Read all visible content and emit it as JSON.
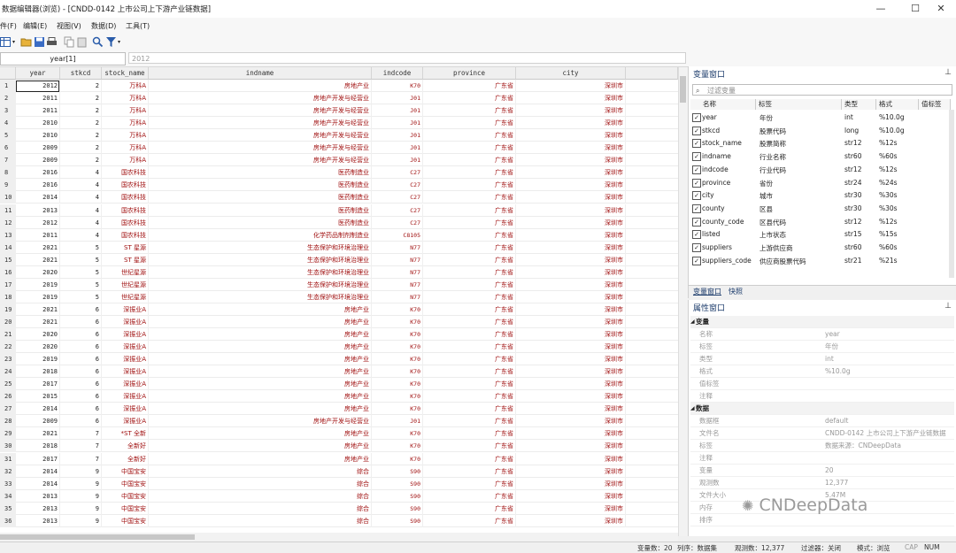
{
  "window": {
    "title": "数据编辑器(浏览) - [CNDD-0142 上市公司上下游产业链数据]",
    "minimize": "—",
    "maximize": "☐",
    "close": "✕"
  },
  "menus": [
    "件(F)",
    "编辑(E)",
    "视图(V)",
    "数据(D)",
    "工具(T)"
  ],
  "toolbar": [
    "table-icon",
    "open-icon",
    "save-icon",
    "print-icon",
    "copy-icon",
    "paste-icon",
    "search-icon",
    "filter-icon"
  ],
  "formula_bar": {
    "cell_ref": "year[1]",
    "value": "2012"
  },
  "grid": {
    "columns": [
      "year",
      "stkcd",
      "stock_name",
      "indname",
      "indcode",
      "province",
      "city"
    ],
    "rows": [
      [
        "2012",
        "2",
        "万科A",
        "房地产业",
        "K70",
        "广东省",
        "深圳市"
      ],
      [
        "2011",
        "2",
        "万科A",
        "房地产开发与经营业",
        "J01",
        "广东省",
        "深圳市"
      ],
      [
        "2011",
        "2",
        "万科A",
        "房地产开发与经营业",
        "J01",
        "广东省",
        "深圳市"
      ],
      [
        "2010",
        "2",
        "万科A",
        "房地产开发与经营业",
        "J01",
        "广东省",
        "深圳市"
      ],
      [
        "2010",
        "2",
        "万科A",
        "房地产开发与经营业",
        "J01",
        "广东省",
        "深圳市"
      ],
      [
        "2009",
        "2",
        "万科A",
        "房地产开发与经营业",
        "J01",
        "广东省",
        "深圳市"
      ],
      [
        "2009",
        "2",
        "万科A",
        "房地产开发与经营业",
        "J01",
        "广东省",
        "深圳市"
      ],
      [
        "2016",
        "4",
        "国农科技",
        "医药制造业",
        "C27",
        "广东省",
        "深圳市"
      ],
      [
        "2016",
        "4",
        "国农科技",
        "医药制造业",
        "C27",
        "广东省",
        "深圳市"
      ],
      [
        "2014",
        "4",
        "国农科技",
        "医药制造业",
        "C27",
        "广东省",
        "深圳市"
      ],
      [
        "2013",
        "4",
        "国农科技",
        "医药制造业",
        "C27",
        "广东省",
        "深圳市"
      ],
      [
        "2012",
        "4",
        "国农科技",
        "医药制造业",
        "C27",
        "广东省",
        "深圳市"
      ],
      [
        "2011",
        "4",
        "国农科技",
        "化学药品制剂制造业",
        "C8105",
        "广东省",
        "深圳市"
      ],
      [
        "2021",
        "5",
        "ST 星源",
        "生态保护和环境治理业",
        "N77",
        "广东省",
        "深圳市"
      ],
      [
        "2021",
        "5",
        "ST 星源",
        "生态保护和环境治理业",
        "N77",
        "广东省",
        "深圳市"
      ],
      [
        "2020",
        "5",
        "世纪星源",
        "生态保护和环境治理业",
        "N77",
        "广东省",
        "深圳市"
      ],
      [
        "2019",
        "5",
        "世纪星源",
        "生态保护和环境治理业",
        "N77",
        "广东省",
        "深圳市"
      ],
      [
        "2019",
        "5",
        "世纪星源",
        "生态保护和环境治理业",
        "N77",
        "广东省",
        "深圳市"
      ],
      [
        "2021",
        "6",
        "深振业A",
        "房地产业",
        "K70",
        "广东省",
        "深圳市"
      ],
      [
        "2021",
        "6",
        "深振业A",
        "房地产业",
        "K70",
        "广东省",
        "深圳市"
      ],
      [
        "2020",
        "6",
        "深振业A",
        "房地产业",
        "K70",
        "广东省",
        "深圳市"
      ],
      [
        "2020",
        "6",
        "深振业A",
        "房地产业",
        "K70",
        "广东省",
        "深圳市"
      ],
      [
        "2019",
        "6",
        "深振业A",
        "房地产业",
        "K70",
        "广东省",
        "深圳市"
      ],
      [
        "2018",
        "6",
        "深振业A",
        "房地产业",
        "K70",
        "广东省",
        "深圳市"
      ],
      [
        "2017",
        "6",
        "深振业A",
        "房地产业",
        "K70",
        "广东省",
        "深圳市"
      ],
      [
        "2015",
        "6",
        "深振业A",
        "房地产业",
        "K70",
        "广东省",
        "深圳市"
      ],
      [
        "2014",
        "6",
        "深振业A",
        "房地产业",
        "K70",
        "广东省",
        "深圳市"
      ],
      [
        "2009",
        "6",
        "深振业A",
        "房地产开发与经营业",
        "J01",
        "广东省",
        "深圳市"
      ],
      [
        "2021",
        "7",
        "*ST 全新",
        "房地产业",
        "K70",
        "广东省",
        "深圳市"
      ],
      [
        "2018",
        "7",
        "全新好",
        "房地产业",
        "K70",
        "广东省",
        "深圳市"
      ],
      [
        "2017",
        "7",
        "全新好",
        "房地产业",
        "K70",
        "广东省",
        "深圳市"
      ],
      [
        "2014",
        "9",
        "中国宝安",
        "综合",
        "S90",
        "广东省",
        "深圳市"
      ],
      [
        "2014",
        "9",
        "中国宝安",
        "综合",
        "S90",
        "广东省",
        "深圳市"
      ],
      [
        "2013",
        "9",
        "中国宝安",
        "综合",
        "S90",
        "广东省",
        "深圳市"
      ],
      [
        "2013",
        "9",
        "中国宝安",
        "综合",
        "S90",
        "广东省",
        "深圳市"
      ],
      [
        "2013",
        "9",
        "中国宝安",
        "综合",
        "S90",
        "广东省",
        "深圳市"
      ]
    ]
  },
  "variables_panel": {
    "title": "变量窗口",
    "filter_placeholder": "过滤变量",
    "headers": [
      "名称",
      "标签",
      "类型",
      "格式",
      "值标签"
    ],
    "items": [
      [
        "year",
        "年份",
        "int",
        "%10.0g"
      ],
      [
        "stkcd",
        "股票代码",
        "long",
        "%10.0g"
      ],
      [
        "stock_name",
        "股票简称",
        "str12",
        "%12s"
      ],
      [
        "indname",
        "行业名称",
        "str60",
        "%60s"
      ],
      [
        "indcode",
        "行业代码",
        "str12",
        "%12s"
      ],
      [
        "province",
        "省份",
        "str24",
        "%24s"
      ],
      [
        "city",
        "城市",
        "str30",
        "%30s"
      ],
      [
        "county",
        "区县",
        "str30",
        "%30s"
      ],
      [
        "county_code",
        "区县代码",
        "str12",
        "%12s"
      ],
      [
        "listed",
        "上市状态",
        "str15",
        "%15s"
      ],
      [
        "suppliers",
        "上游供应商",
        "str60",
        "%60s"
      ],
      [
        "suppliers_code",
        "供应商股票代码",
        "str21",
        "%21s"
      ]
    ]
  },
  "tabs": [
    "变量窗口",
    "快照"
  ],
  "properties_panel": {
    "title": "属性窗口",
    "sections": [
      {
        "name": "变量",
        "rows": [
          [
            "名称",
            "year"
          ],
          [
            "标签",
            "年份"
          ],
          [
            "类型",
            "int"
          ],
          [
            "格式",
            "%10.0g"
          ],
          [
            "值标签",
            ""
          ],
          [
            "注释",
            ""
          ]
        ]
      },
      {
        "name": "数据",
        "rows": [
          [
            "数据框",
            "default"
          ],
          [
            "文件名",
            "CNDD-0142 上市公司上下游产业链数据"
          ],
          [
            "标签",
            "数据来源：CNDeepData"
          ],
          [
            "注释",
            ""
          ],
          [
            "变量",
            "20"
          ],
          [
            "观测数",
            "12,377"
          ],
          [
            "文件大小",
            "5.47M"
          ],
          [
            "内存",
            ""
          ],
          [
            "排序",
            ""
          ]
        ]
      }
    ]
  },
  "status_bar": {
    "vars": "变量数：20",
    "order": "列序：数据集",
    "obs": "观测数：12,377",
    "filter": "过滤器：关闭",
    "mode": "模式：浏览",
    "cap": "CAP",
    "num": "NUM"
  },
  "watermark": "CNDeepData",
  "colors": {
    "string_text": "#a01010",
    "panel_title": "#1a3a6a"
  }
}
